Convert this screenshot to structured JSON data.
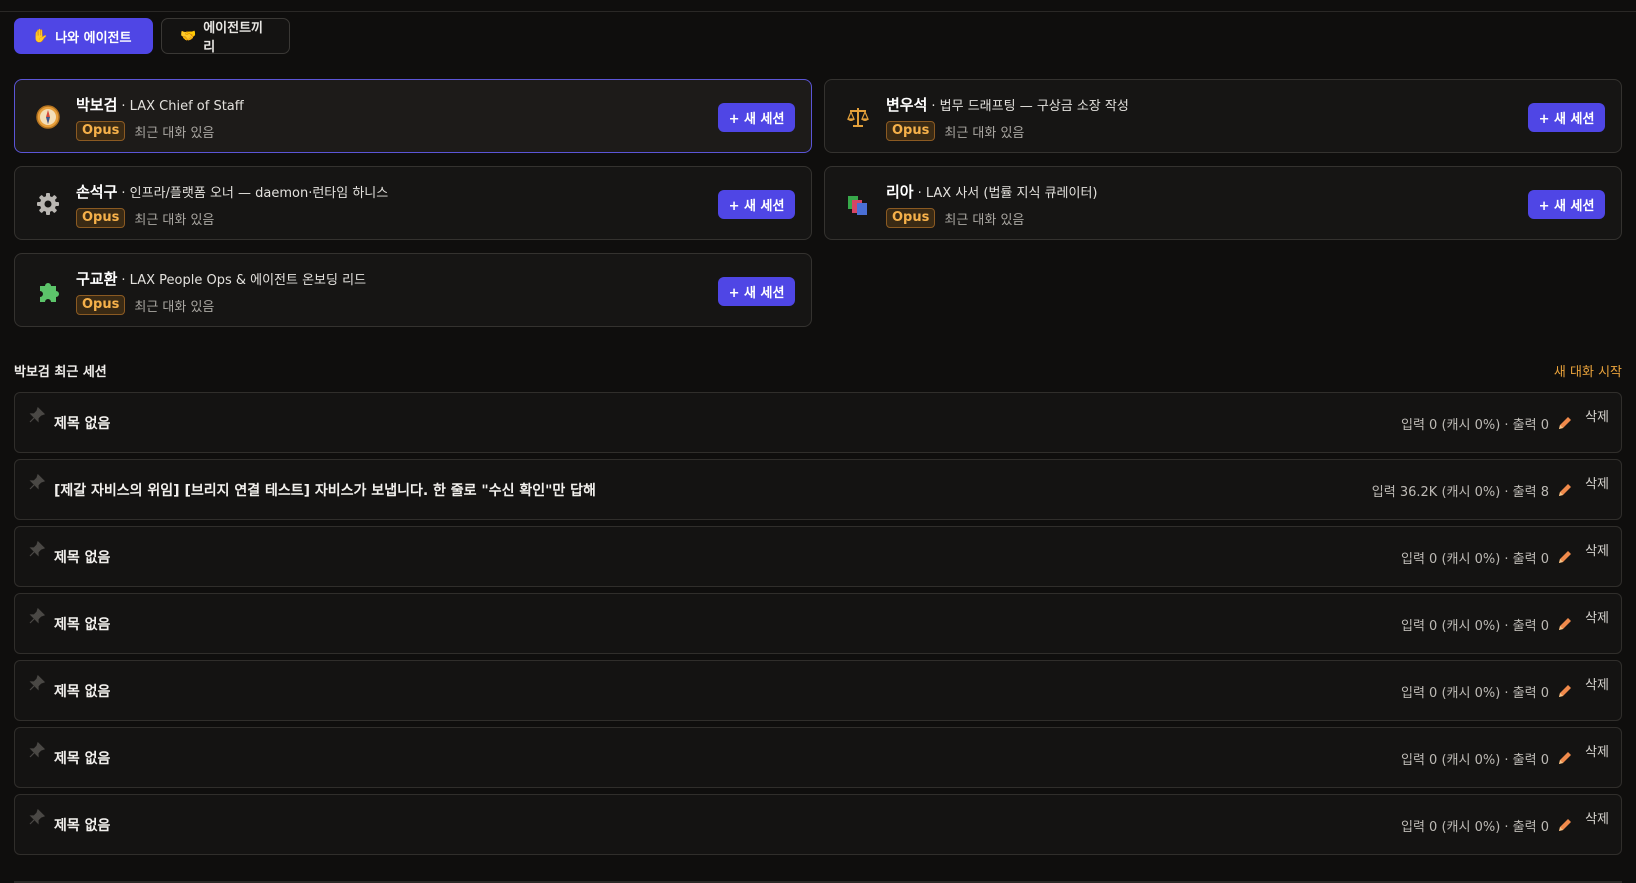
{
  "tabs": [
    {
      "label": "나와 에이전트",
      "icon": "hand-emoji",
      "active": true
    },
    {
      "label": "에이전트끼리",
      "icon": "handshake-emoji",
      "active": false
    }
  ],
  "agents": [
    {
      "name": "박보검",
      "role": "· LAX Chief of Staff",
      "badge": "Opus",
      "status": "최근 대화 있음",
      "button": "+ 새 세션",
      "icon": "compass-icon",
      "selected": true
    },
    {
      "name": "변우석",
      "role": "· 법무 드래프팅 — 구상금 소장 작성",
      "badge": "Opus",
      "status": "최근 대화 있음",
      "button": "+ 새 세션",
      "icon": "scales-icon",
      "selected": false
    },
    {
      "name": "손석구",
      "role": "· 인프라/플랫폼 오너 — daemon·런타임 하니스",
      "badge": "Opus",
      "status": "최근 대화 있음",
      "button": "+ 새 세션",
      "icon": "gear-icon",
      "selected": false
    },
    {
      "name": "리아",
      "role": "· LAX 사서 (법률 지식 큐레이터)",
      "badge": "Opus",
      "status": "최근 대화 있음",
      "button": "+ 새 세션",
      "icon": "books-icon",
      "selected": false
    },
    {
      "name": "구교환",
      "role": "· LAX People Ops & 에이전트 온보딩 리드",
      "badge": "Opus",
      "status": "최근 대화 있음",
      "button": "+ 새 세션",
      "icon": "puzzle-icon",
      "selected": false
    }
  ],
  "sessions": {
    "title": "박보검 최근 세션",
    "start_link": "새 대화 시작",
    "delete_label": "삭제",
    "items": [
      {
        "title": "제목 없음",
        "usage": "입력 0 (캐시 0%) · 출력 0"
      },
      {
        "title": "[제갈 자비스의 위임] [브리지 연결 테스트] 자비스가 보냅니다. 한 줄로 \"수신 확인\"만 답해",
        "usage": "입력 36.2K (캐시 0%) · 출력 8"
      },
      {
        "title": "제목 없음",
        "usage": "입력 0 (캐시 0%) · 출력 0"
      },
      {
        "title": "제목 없음",
        "usage": "입력 0 (캐시 0%) · 출력 0"
      },
      {
        "title": "제목 없음",
        "usage": "입력 0 (캐시 0%) · 출력 0"
      },
      {
        "title": "제목 없음",
        "usage": "입력 0 (캐시 0%) · 출력 0"
      },
      {
        "title": "제목 없음",
        "usage": "입력 0 (캐시 0%) · 출력 0"
      }
    ]
  },
  "colors": {
    "accent": "#4f46e5",
    "badge": "#f6b14a",
    "link": "#e9a23b",
    "edit": "#f08a4b"
  }
}
